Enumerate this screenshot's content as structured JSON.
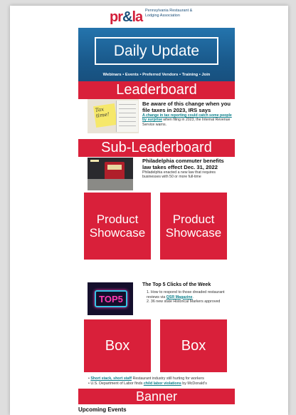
{
  "header": {
    "logo_mark_left": "pr",
    "logo_mark_amp": "&",
    "logo_mark_right": "la",
    "logo_text": "Pennsylvania Restaurant & Lodging Association"
  },
  "hero": {
    "title": "Daily Update",
    "links": "Webinars • Events • Preferred Vendors • Training • Join"
  },
  "ads": {
    "leaderboard": "Leaderboard",
    "sub_leaderboard": "Sub-Leaderboard",
    "product_showcase_1": "Product Showcase",
    "product_showcase_2": "Product Showcase",
    "box_1": "Box",
    "box_2": "Box",
    "banner": "Banner"
  },
  "articles": [
    {
      "title": "Be aware of this change when you file taxes in 2023, IRS says",
      "link_text": "A change in tax reporting could catch some people by surprise",
      "body_rest": " when filing in 2023, the Internal Revenue Service warns.",
      "thumb_note": "Tax time!"
    },
    {
      "title": "Philadelphia commuter benefits law takes effect Dec. 31, 2022",
      "body": "Philadelphia enacted a new law that requires businesses with 50 or more full-time"
    }
  ],
  "top5": {
    "title": "The Top 5 Clicks of the Week",
    "sign": "TOP5",
    "items": [
      {
        "num": "1.",
        "text": "How to respond to those dreaded restaurant reviews via ",
        "link": "QSR Magazine",
        "tail": "."
      },
      {
        "num": "2.",
        "text": "36 new state Historical Markers approved",
        "link": "",
        "tail": ""
      }
    ]
  },
  "news_bullets": [
    {
      "link": "Short stack, short staff",
      "text": "  Restaurant industry still hurting for workers"
    },
    {
      "pre": "U.S. Department of Labor finds ",
      "link": "child labor violations",
      "text": " by McDonald's"
    }
  ],
  "sections": {
    "upcoming_events": "Upcoming Events"
  },
  "colors": {
    "accent_red": "#d9203a",
    "hero_blue": "#1d5f92",
    "link_teal": "#0b7f8a"
  }
}
